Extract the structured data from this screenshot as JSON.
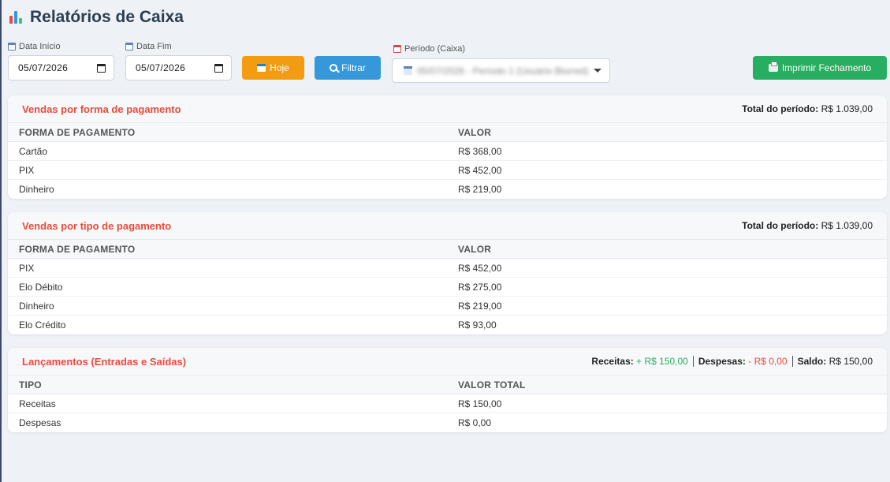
{
  "page": {
    "title": "Relatórios de Caixa"
  },
  "filters": {
    "start_label": "Data Início",
    "start_value": "05/07/2026",
    "end_label": "Data Fim",
    "end_value": "05/07/2026",
    "today_button": "Hoje",
    "filter_button": "Filtrar",
    "period_label": "Período (Caixa)",
    "period_value": "05/07/2026 - Período 1 (Usuário Blurred)",
    "print_button": "Imprimir Fechamento"
  },
  "payment_forms": {
    "title": "Vendas por forma de pagamento",
    "total_label": "Total do período:",
    "total_value": "R$ 1.039,00",
    "columns": [
      "FORMA DE PAGAMENTO",
      "VALOR"
    ],
    "rows": [
      [
        "Cartão",
        "R$ 368,00"
      ],
      [
        "PIX",
        "R$ 452,00"
      ],
      [
        "Dinheiro",
        "R$ 219,00"
      ]
    ]
  },
  "payment_types": {
    "title": "Vendas por tipo de pagamento",
    "total_label": "Total do período:",
    "total_value": "R$ 1.039,00",
    "columns": [
      "FORMA DE PAGAMENTO",
      "VALOR"
    ],
    "rows": [
      [
        "PIX",
        "R$ 452,00"
      ],
      [
        "Elo Débito",
        "R$ 275,00"
      ],
      [
        "Dinheiro",
        "R$ 219,00"
      ],
      [
        "Elo Crédito",
        "R$ 93,00"
      ]
    ]
  },
  "entries": {
    "title": "Lançamentos (Entradas e Saídas)",
    "income_label": "Receitas:",
    "income_value": "+ R$ 150,00",
    "expense_label": "Despesas:",
    "expense_value": "- R$ 0,00",
    "balance_label": "Saldo:",
    "balance_value": "R$ 150,00",
    "columns": [
      "TIPO",
      "VALOR TOTAL"
    ],
    "rows": [
      [
        "Receitas",
        "R$ 150,00"
      ],
      [
        "Despesas",
        "R$ 0,00"
      ]
    ]
  },
  "colors": {
    "accent_red": "#e74c3c",
    "orange": "#f39c12",
    "blue": "#3498db",
    "green": "#27ae60"
  },
  "icons": [
    "bar-chart-icon",
    "calendar-icon",
    "search-icon",
    "printer-icon",
    "chevron-down-icon"
  ]
}
